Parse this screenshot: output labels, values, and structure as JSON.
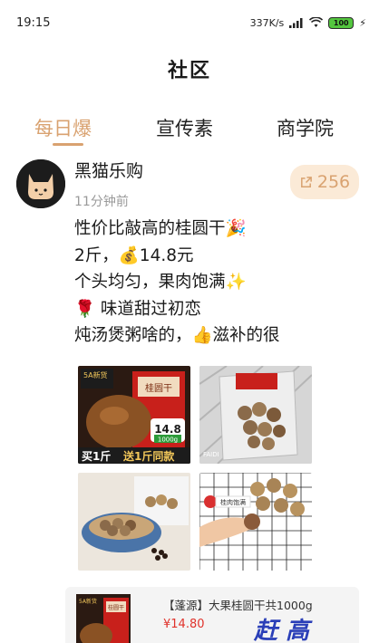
{
  "status_bar": {
    "time": "19:15",
    "network_speed": "337K/s",
    "battery": "100"
  },
  "nav": {
    "title": "社区"
  },
  "tabs": [
    {
      "label": "每日爆",
      "active": true
    },
    {
      "label": "宣传素",
      "active": false
    },
    {
      "label": "商学院",
      "active": false
    }
  ],
  "post": {
    "author": "黑猫乐购",
    "time_ago": "11分钟前",
    "share_count": "256",
    "lines": [
      "性价比敲高的桂圆干🎉",
      "2斤，💰14.8元",
      "个头均匀，果肉饱满✨",
      "🌹 味道甜过初恋",
      "炖汤煲粥啥的，👍滋补的很"
    ],
    "images": [
      {
        "icon": "longan-package-photo",
        "tag": "5A新货",
        "package": "桂圆干",
        "price": "14.8",
        "weight": "1000g",
        "banner_a": "买1斤",
        "banner_b": "送1斤同款"
      },
      {
        "icon": "longan-bag-photo",
        "caption": "FAIDI"
      },
      {
        "icon": "longan-basket-photo"
      },
      {
        "icon": "longan-hand-photo",
        "sticker": "桂肉饱满"
      }
    ]
  },
  "product_card": {
    "name": "【蓬源】大果桂圆干共1000g",
    "price": "¥14.80",
    "thumb_tag": "5A新货",
    "thumb_package": "桂圆干",
    "overlay_text": "赶 高"
  },
  "colors": {
    "accent": "#d9a270",
    "price": "#e0322b",
    "share_bg": "#fbead7"
  }
}
